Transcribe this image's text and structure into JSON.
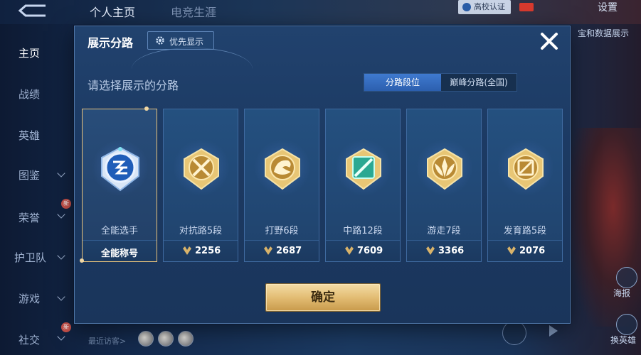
{
  "background": {
    "top_tabs": [
      "个人主页",
      "电竞生涯"
    ],
    "school_badge": "高校认证",
    "settings_label": "设置",
    "right_hint": "宝和数据展示",
    "sidebar": {
      "items": [
        {
          "label": "主页",
          "active": true
        },
        {
          "label": "战绩"
        },
        {
          "label": "英雄"
        },
        {
          "label": "图鉴"
        },
        {
          "label": "荣誉"
        },
        {
          "label": "护卫队"
        },
        {
          "label": "游戏"
        },
        {
          "label": "社交"
        }
      ],
      "new_badge": "新"
    },
    "recent_visitors_label": "最近访客>",
    "right_buttons": [
      "海报",
      "换英雄"
    ]
  },
  "dialog": {
    "title": "展示分路",
    "priority_button": "优先显示",
    "subtitle": "请选择展示的分路",
    "segmented": {
      "active": "分路段位",
      "inactive": "巅峰分路(全国)"
    },
    "cards": [
      {
        "name": "全能选手",
        "bottom": "全能称号",
        "emblem": "all-round-emblem-icon",
        "selected": true
      },
      {
        "name": "对抗路5段",
        "points": "2256",
        "emblem": "clash-lane-emblem-icon"
      },
      {
        "name": "打野6段",
        "points": "2687",
        "emblem": "jungle-emblem-icon"
      },
      {
        "name": "中路12段",
        "points": "7609",
        "emblem": "mid-lane-emblem-icon"
      },
      {
        "name": "游走7段",
        "points": "3366",
        "emblem": "roam-emblem-icon"
      },
      {
        "name": "发育路5段",
        "points": "2076",
        "emblem": "farm-lane-emblem-icon"
      }
    ],
    "confirm_label": "确定"
  },
  "colors": {
    "gold": "#e3bd74",
    "selected_border": "#e7c27b",
    "tab_active": "#3f7ad0",
    "card_bg": "#224a78",
    "mid_emblem_teal": "#2aa892"
  }
}
